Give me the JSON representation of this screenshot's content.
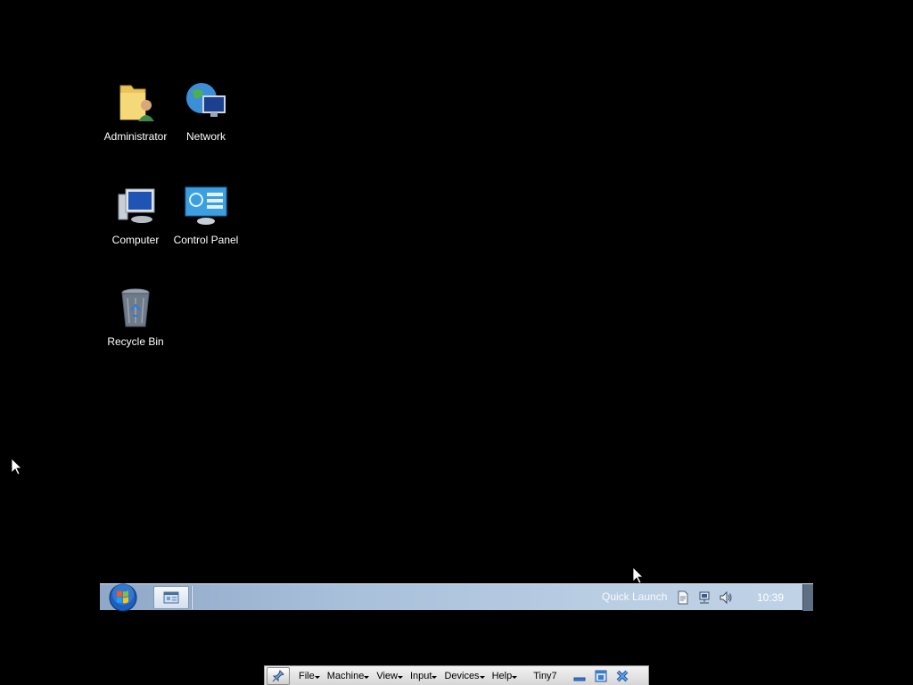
{
  "desktop": {
    "icons": [
      {
        "label": "Administrator",
        "icon": "user-folder-icon"
      },
      {
        "label": "Network",
        "icon": "network-icon"
      },
      {
        "label": "Computer",
        "icon": "computer-icon"
      },
      {
        "label": "Control Panel",
        "icon": "control-panel-icon"
      },
      {
        "label": "Recycle Bin",
        "icon": "recycle-bin-icon"
      }
    ]
  },
  "taskbar": {
    "start_icon": "start-orb-icon",
    "quick_launch_label": "Quick Launch",
    "clock": "10:39",
    "colors": {
      "accent": "#a9c0db",
      "start_orb": "#1b5fbf"
    }
  },
  "vbox_toolbar": {
    "menus": [
      "File",
      "Machine",
      "View",
      "Input",
      "Devices",
      "Help"
    ],
    "vm_name": "Tiny7",
    "controls": [
      "minimize-icon",
      "restore-icon",
      "close-icon"
    ]
  }
}
